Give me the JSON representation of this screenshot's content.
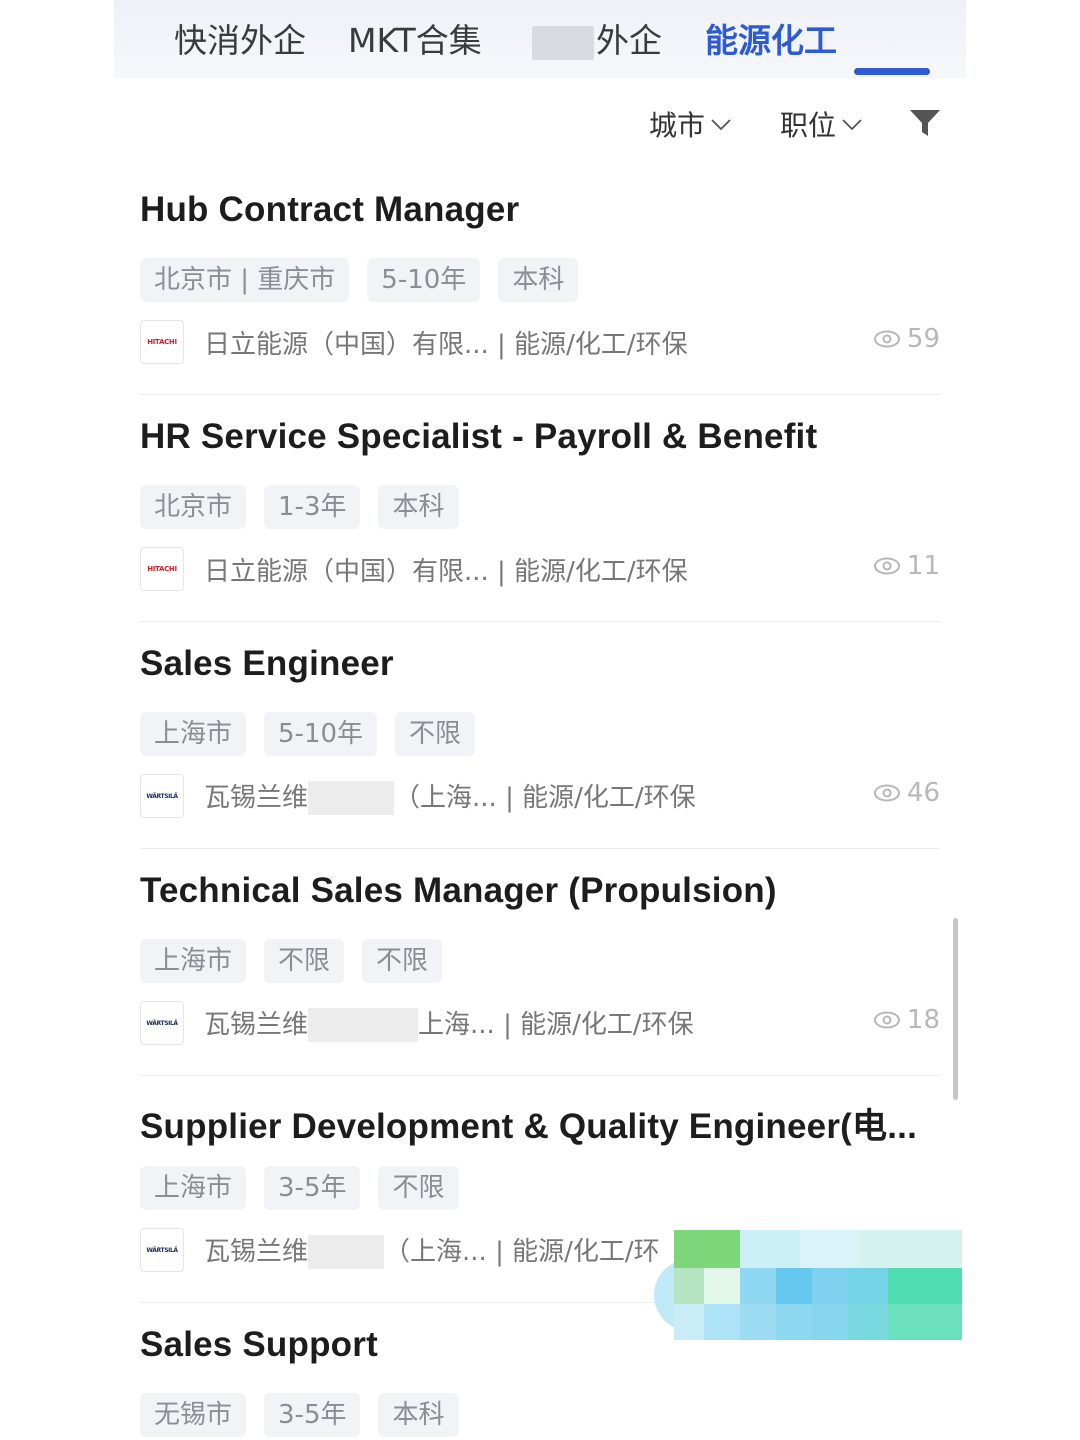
{
  "tabs": [
    {
      "label": "快消外企",
      "active": false
    },
    {
      "label": "MKT合集",
      "active": false
    },
    {
      "label": "外企",
      "active": false
    },
    {
      "label": "能源化工",
      "active": true
    }
  ],
  "filters": {
    "city_label": "城市",
    "position_label": "职位",
    "funnel_icon": "funnel-icon"
  },
  "jobs": [
    {
      "title": "Hub Contract Manager",
      "tags": [
        "北京市 | 重庆市",
        "5-10年",
        "本科"
      ],
      "company": "日立能源（中国）有限... | 能源/化工/环保",
      "logo": "HITACHI",
      "views": "59"
    },
    {
      "title": "HR Service Specialist - Payroll & Benefit",
      "tags": [
        "北京市",
        "1-3年",
        "本科"
      ],
      "company": "日立能源（中国）有限... | 能源/化工/环保",
      "logo": "HITACHI",
      "views": "11"
    },
    {
      "title": "Sales Engineer",
      "tags": [
        "上海市",
        "5-10年",
        "不限"
      ],
      "company_prefix": "瓦锡兰维",
      "company_suffix": "（上海... | 能源/化工/环保",
      "logo": "WÄRTSILÄ",
      "views": "46"
    },
    {
      "title": "Technical Sales Manager (Propulsion)",
      "tags": [
        "上海市",
        "不限",
        "不限"
      ],
      "company_prefix": "瓦锡兰维",
      "company_suffix": "上海... | 能源/化工/环保",
      "logo": "WÄRTSILÄ",
      "views": "18"
    },
    {
      "title": "Supplier Development & Quality Engineer(电...",
      "tags": [
        "上海市",
        "3-5年",
        "不限"
      ],
      "company_prefix": "瓦锡兰维",
      "company_suffix": "（上海... | 能源/化工/环",
      "logo": "WÄRTSILÄ"
    },
    {
      "title": "Sales Support",
      "tags": [
        "无锡市",
        "3-5年",
        "本科"
      ]
    }
  ],
  "colors": {
    "accent": "#2e5bd2",
    "tag_bg": "#f1f3f7",
    "tag_text": "#8a8d93"
  }
}
